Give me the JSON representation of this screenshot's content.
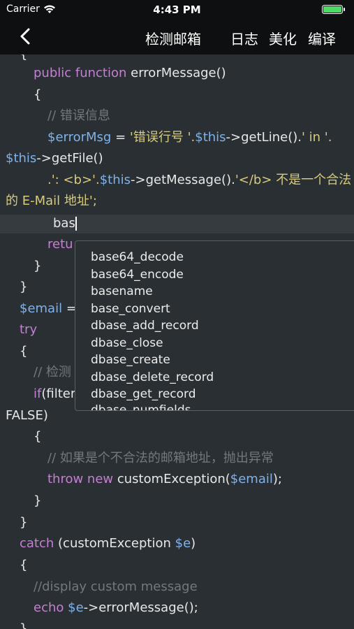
{
  "status": {
    "carrier": "Carrier",
    "time": "4:43 PM"
  },
  "nav": {
    "back_icon": "chevron-left-icon",
    "title": "检测邮箱",
    "links": [
      "日志",
      "美化",
      "编译"
    ]
  },
  "code": {
    "l1": {
      "kw": "public function",
      "txt": " errorMessage()"
    },
    "l2": "{",
    "l3": "// 错误信息",
    "l4": {
      "var": "$errorMsg",
      "eq": " = ",
      "s1": "'错误行号 '.",
      "this": "$this",
      "call": "->getLine().",
      "s2": "' in '."
    },
    "l5": {
      "this": "$this",
      "call": "->getFile()"
    },
    "l6": {
      "s1": ".': <b>'.",
      "this": "$this",
      "call": "->getMessage().",
      "s2": "'</b> 不是一个合法"
    },
    "l7": "的 E-Mail 地址';",
    "l8": "bas",
    "l9": "retu",
    "l10": "}",
    "l11": "}",
    "l12": {
      "var": "$email",
      "txt": " ="
    },
    "l13": "try",
    "l14": "{",
    "l15": "// 检测",
    "l16": {
      "kw": "if",
      "txt": "(filter"
    },
    "l17": "FALSE)",
    "l18": "{",
    "l19": "// 如果是个不合法的邮箱地址，抛出异常",
    "l20": {
      "kw": "throw new",
      "txt": " customException(",
      "var": "$email",
      "end": ");"
    },
    "l21": "}",
    "l22": "}",
    "l23": {
      "kw": "catch",
      "txt": " (customException ",
      "var": "$e",
      "end": ")"
    },
    "l24": "{",
    "l25": "//display custom message",
    "l26": {
      "kw": "echo",
      "var": " $e",
      "txt": "->errorMessage();"
    }
  },
  "autocomplete": [
    "base64_decode",
    "base64_encode",
    "basename",
    "base_convert",
    "dbase_add_record",
    "dbase_close",
    "dbase_create",
    "dbase_delete_record",
    "dbase_get_record",
    "dbase_numfields"
  ],
  "colors": {
    "background": "#2a2f33",
    "keyword": "#c57fd3",
    "variable": "#7fb2ea",
    "string": "#d6cb7f",
    "comment": "#717880"
  }
}
